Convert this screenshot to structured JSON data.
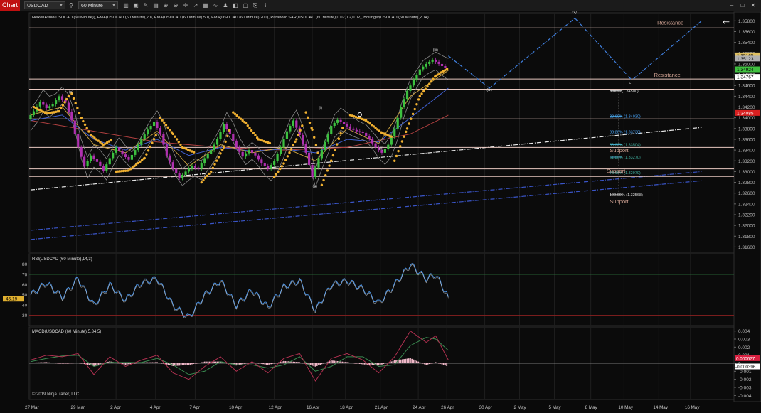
{
  "toolbar": {
    "chart_tab": "Chart",
    "instrument": "USDCAD",
    "period": "60 Minute",
    "icons": [
      "search-icon",
      "bar-chart-icon",
      "properties-icon",
      "pencil-icon",
      "templates-icon",
      "zoom-icon",
      "zoom-out-icon",
      "crosshair-icon",
      "draw-object-icon",
      "hide-panel-icon",
      "indicators-icon",
      "strategies-icon",
      "chart-style-icon",
      "data-box-icon",
      "attach-icon",
      "share-icon"
    ],
    "window_buttons": [
      "minimize-button",
      "maximize-button",
      "close-button"
    ]
  },
  "chart_data": {
    "type": "line",
    "title": "HeikenAshi8(USDCAD (60 Minute)), EMA(USDCAD (60 Minute),20), EMA(USDCAD (60 Minute),50), EMA(USDCAD (60 Minute),200), Parabolic SAR(USDCAD (60 Minute),0.02,0.2,0.02), Bollinger(USDCAD (60 Minute),2,14)",
    "x_labels": [
      "27 Mar",
      "29 Mar",
      "2 Apr",
      "4 Apr",
      "7 Apr",
      "10 Apr",
      "12 Apr",
      "16 Apr",
      "18 Apr",
      "21 Apr",
      "24 Apr",
      "26 Apr",
      "30 Apr",
      "2 May",
      "5 May",
      "8 May",
      "10 May",
      "14 May",
      "16 May"
    ],
    "price_panel": {
      "ylim": [
        1.315,
        1.3595
      ],
      "y_ticks": [
        "1.35800",
        "1.35600",
        "1.35400",
        "1.35200",
        "1.35000",
        "1.34800",
        "1.34600",
        "1.34400",
        "1.34200",
        "1.34000",
        "1.33800",
        "1.33600",
        "1.33400",
        "1.33200",
        "1.33000",
        "1.32800",
        "1.32600",
        "1.32400",
        "1.32200",
        "1.32000",
        "1.31800",
        "1.31600"
      ],
      "price_path": [
        [
          0,
          1.3398
        ],
        [
          2,
          1.3412
        ],
        [
          4,
          1.343
        ],
        [
          6,
          1.3418
        ],
        [
          8,
          1.3425
        ],
        [
          10,
          1.344
        ],
        [
          12,
          1.3428
        ],
        [
          14,
          1.3395
        ],
        [
          16,
          1.3345
        ],
        [
          18,
          1.331
        ],
        [
          20,
          1.333
        ],
        [
          22,
          1.3318
        ],
        [
          24,
          1.3302
        ],
        [
          26,
          1.3325
        ],
        [
          28,
          1.3345
        ],
        [
          30,
          1.3332
        ],
        [
          32,
          1.3322
        ],
        [
          34,
          1.334
        ],
        [
          36,
          1.336
        ],
        [
          38,
          1.3378
        ],
        [
          40,
          1.3392
        ],
        [
          42,
          1.337
        ],
        [
          44,
          1.333
        ],
        [
          46,
          1.3305
        ],
        [
          48,
          1.3288
        ],
        [
          50,
          1.33
        ],
        [
          52,
          1.331
        ],
        [
          54,
          1.3305
        ],
        [
          56,
          1.3325
        ],
        [
          58,
          1.334
        ],
        [
          60,
          1.336
        ],
        [
          62,
          1.3388
        ],
        [
          64,
          1.337
        ],
        [
          66,
          1.3345
        ],
        [
          68,
          1.3328
        ],
        [
          70,
          1.334
        ],
        [
          72,
          1.333
        ],
        [
          74,
          1.3315
        ],
        [
          76,
          1.3305
        ],
        [
          78,
          1.332
        ],
        [
          80,
          1.3345
        ],
        [
          82,
          1.3375
        ],
        [
          84,
          1.3395
        ],
        [
          86,
          1.3368
        ],
        [
          88,
          1.3335
        ],
        [
          90,
          1.329
        ],
        [
          92,
          1.3325
        ],
        [
          94,
          1.3355
        ],
        [
          96,
          1.3385
        ],
        [
          98,
          1.3396
        ],
        [
          100,
          1.3388
        ],
        [
          102,
          1.338
        ],
        [
          104,
          1.3375
        ],
        [
          106,
          1.3372
        ],
        [
          108,
          1.336
        ],
        [
          110,
          1.3345
        ],
        [
          112,
          1.3335
        ],
        [
          114,
          1.335
        ],
        [
          116,
          1.338
        ],
        [
          118,
          1.342
        ],
        [
          120,
          1.345
        ],
        [
          122,
          1.347
        ],
        [
          124,
          1.349
        ],
        [
          126,
          1.35
        ],
        [
          128,
          1.3508
        ],
        [
          130,
          1.35
        ],
        [
          132,
          1.3492
        ]
      ],
      "ema20": [
        [
          0,
          1.3405
        ],
        [
          10,
          1.342
        ],
        [
          20,
          1.335
        ],
        [
          30,
          1.3335
        ],
        [
          40,
          1.3375
        ],
        [
          50,
          1.331
        ],
        [
          60,
          1.335
        ],
        [
          70,
          1.3335
        ],
        [
          80,
          1.3345
        ],
        [
          90,
          1.332
        ],
        [
          100,
          1.338
        ],
        [
          110,
          1.3352
        ],
        [
          120,
          1.344
        ],
        [
          132,
          1.3488
        ]
      ],
      "ema50": [
        [
          0,
          1.3395
        ],
        [
          10,
          1.3405
        ],
        [
          20,
          1.336
        ],
        [
          30,
          1.334
        ],
        [
          40,
          1.336
        ],
        [
          50,
          1.333
        ],
        [
          60,
          1.3345
        ],
        [
          70,
          1.3338
        ],
        [
          80,
          1.3342
        ],
        [
          90,
          1.3335
        ],
        [
          100,
          1.336
        ],
        [
          110,
          1.3355
        ],
        [
          120,
          1.34
        ],
        [
          132,
          1.3455
        ]
      ],
      "ema200": [
        [
          0,
          1.3395
        ],
        [
          20,
          1.3375
        ],
        [
          40,
          1.3355
        ],
        [
          60,
          1.3345
        ],
        [
          80,
          1.334
        ],
        [
          100,
          1.3345
        ],
        [
          120,
          1.337
        ],
        [
          132,
          1.3405
        ]
      ],
      "sar_segments": [
        [
          [
            1,
            1.342
          ],
          [
            5,
            1.3408
          ],
          [
            9,
            1.3412
          ],
          [
            12,
            1.344
          ]
        ],
        [
          [
            13,
            1.3445
          ],
          [
            16,
            1.34
          ],
          [
            19,
            1.3368
          ],
          [
            23,
            1.335
          ],
          [
            26,
            1.336
          ]
        ],
        [
          [
            27,
            1.33
          ],
          [
            31,
            1.3302
          ],
          [
            36,
            1.3325
          ],
          [
            40,
            1.3372
          ]
        ],
        [
          [
            41,
            1.34
          ],
          [
            45,
            1.337
          ],
          [
            48,
            1.3345
          ],
          [
            52,
            1.3335
          ]
        ],
        [
          [
            54,
            1.328
          ],
          [
            57,
            1.33
          ],
          [
            61,
            1.3345
          ],
          [
            63,
            1.338
          ]
        ],
        [
          [
            64,
            1.341
          ],
          [
            68,
            1.339
          ],
          [
            72,
            1.336
          ],
          [
            76,
            1.3352
          ]
        ],
        [
          [
            77,
            1.329
          ],
          [
            80,
            1.3315
          ],
          [
            84,
            1.336
          ],
          [
            86,
            1.3388
          ]
        ],
        [
          [
            87,
            1.341
          ],
          [
            89,
            1.3378
          ],
          [
            91,
            1.333
          ]
        ],
        [
          [
            92,
            1.3275
          ],
          [
            95,
            1.332
          ],
          [
            99,
            1.3388
          ]
        ],
        [
          [
            101,
            1.3405
          ],
          [
            106,
            1.3395
          ],
          [
            111,
            1.3372
          ],
          [
            114,
            1.3365
          ]
        ],
        [
          [
            115,
            1.332
          ],
          [
            119,
            1.338
          ],
          [
            123,
            1.344
          ],
          [
            128,
            1.3478
          ],
          [
            132,
            1.3492
          ]
        ]
      ],
      "horizontal_levels": [
        1.3567,
        1.3472,
        1.3453,
        1.3398,
        1.3383,
        1.3345,
        1.3305,
        1.3291
      ],
      "fibonacci": [
        {
          "label": "0.00% (1.34500)",
          "value": 1.345
        },
        {
          "label": "23.60% (1.34030)",
          "value": 1.3403
        },
        {
          "label": "38.20% (1.33738)",
          "value": 1.3374
        },
        {
          "label": "50.00% (1.33504)",
          "value": 1.335
        },
        {
          "label": "61.80% (1.33270)",
          "value": 1.3327
        },
        {
          "label": "78.60% (1.32979)",
          "value": 1.3298
        },
        {
          "label": "100.00% (1.32568)",
          "value": 1.3257
        }
      ],
      "projection_path": [
        [
          132,
          1.3515
        ],
        [
          145,
          1.3455
        ],
        [
          172,
          1.3585
        ],
        [
          190,
          1.347
        ],
        [
          212,
          1.358
        ]
      ],
      "wave_labels": [
        {
          "text": "(x)",
          "x": 13,
          "y": 1.3446
        },
        {
          "text": "(y)",
          "x": 90,
          "y": 1.3271
        },
        {
          "text": "(i)",
          "x": 92,
          "y": 1.3416
        },
        {
          "text": "(ii)",
          "x": 111,
          "y": 1.3341
        },
        {
          "text": "(iii)",
          "x": 128,
          "y": 1.3524
        },
        {
          "text": "(iv)",
          "x": 145,
          "y": 1.345
        },
        {
          "text": "(v)",
          "x": 172,
          "y": 1.3595
        },
        {
          "text": "c",
          "x": 190,
          "y": 1.3463
        }
      ],
      "zone_labels": [
        {
          "text": "Resistance",
          "value": 1.3573,
          "x": 198
        },
        {
          "text": "Resistance",
          "value": 1.3476,
          "x": 197
        },
        {
          "text": "Support",
          "value": 1.3336,
          "x": 183
        },
        {
          "text": "Support",
          "value": 1.3298,
          "x": 182
        },
        {
          "text": "Support",
          "value": 1.3241,
          "x": 183
        }
      ],
      "trendlines": [
        {
          "style": "white",
          "from": [
            0,
            1.3266
          ],
          "to": [
            212,
            1.3382
          ]
        },
        {
          "style": "blue",
          "from": [
            0,
            1.3191
          ],
          "to": [
            212,
            1.33
          ]
        },
        {
          "style": "blue",
          "from": [
            0,
            1.3174
          ],
          "to": [
            212,
            1.3283
          ]
        }
      ],
      "price_tags": [
        {
          "text": "1.35165",
          "value": 1.3516,
          "bg": "#e0c060",
          "fg": "#000"
        },
        {
          "text": "1.35123",
          "value": 1.351,
          "bg": "#b0b0b0",
          "fg": "#000"
        },
        {
          "text": "1.34924",
          "value": 1.349,
          "bg": "#40c040",
          "fg": "#000"
        },
        {
          "text": "1.34767",
          "value": 1.3476,
          "bg": "#ffffff",
          "fg": "#000"
        },
        {
          "text": "1.34085",
          "value": 1.3409,
          "bg": "#d82020",
          "fg": "#fff"
        }
      ]
    },
    "rsi_panel": {
      "title": "RSI(USDCAD (60 Minute),14,3)",
      "ylim": [
        20,
        90
      ],
      "y_ticks": [
        "80",
        "70",
        "60",
        "50",
        "40",
        "30"
      ],
      "levels": [
        70,
        30
      ],
      "current_value": "46.19",
      "series": [
        [
          0,
          50
        ],
        [
          5,
          62
        ],
        [
          10,
          48
        ],
        [
          15,
          66
        ],
        [
          20,
          40
        ],
        [
          25,
          60
        ],
        [
          30,
          45
        ],
        [
          35,
          62
        ],
        [
          40,
          66
        ],
        [
          45,
          40
        ],
        [
          50,
          28
        ],
        [
          55,
          50
        ],
        [
          60,
          64
        ],
        [
          65,
          40
        ],
        [
          70,
          55
        ],
        [
          75,
          38
        ],
        [
          80,
          58
        ],
        [
          85,
          64
        ],
        [
          90,
          35
        ],
        [
          95,
          60
        ],
        [
          100,
          64
        ],
        [
          105,
          56
        ],
        [
          110,
          42
        ],
        [
          115,
          60
        ],
        [
          120,
          80
        ],
        [
          125,
          66
        ],
        [
          128,
          70
        ],
        [
          132,
          48
        ]
      ]
    },
    "macd_panel": {
      "title": "MACD(USDCAD (60 Minute),5,34,5)",
      "ylim": [
        -0.0045,
        0.0045
      ],
      "y_ticks": [
        "0.004",
        "0.003",
        "0.002",
        "0.001",
        "0",
        "-0.001",
        "-0.002",
        "-0.003",
        "-0.004"
      ],
      "current_values": [
        "0.000627",
        "-0.000396"
      ],
      "macd": [
        [
          0,
          0.0004
        ],
        [
          5,
          0.001
        ],
        [
          10,
          0.0008
        ],
        [
          15,
          0.0012
        ],
        [
          20,
          -0.0014
        ],
        [
          25,
          0.0008
        ],
        [
          30,
          -0.0004
        ],
        [
          35,
          0.0004
        ],
        [
          40,
          0.001
        ],
        [
          45,
          -0.0012
        ],
        [
          50,
          -0.002
        ],
        [
          55,
          -0.0004
        ],
        [
          60,
          0.0008
        ],
        [
          65,
          -0.001
        ],
        [
          70,
          0.0002
        ],
        [
          75,
          -0.0012
        ],
        [
          80,
          0.0006
        ],
        [
          85,
          0.0012
        ],
        [
          90,
          -0.0022
        ],
        [
          95,
          0.0006
        ],
        [
          100,
          0.0012
        ],
        [
          105,
          0.0004
        ],
        [
          110,
          -0.0012
        ],
        [
          115,
          0.0008
        ],
        [
          120,
          0.004
        ],
        [
          125,
          0.0026
        ],
        [
          128,
          0.0034
        ],
        [
          132,
          0.0004
        ]
      ],
      "signal": [
        [
          0,
          0.0002
        ],
        [
          5,
          0.0006
        ],
        [
          10,
          0.0009
        ],
        [
          15,
          0.001
        ],
        [
          20,
          -0.0004
        ],
        [
          25,
          0.0001
        ],
        [
          30,
          0.0001
        ],
        [
          35,
          0.0001
        ],
        [
          40,
          0.0006
        ],
        [
          45,
          -0.0002
        ],
        [
          50,
          -0.0014
        ],
        [
          55,
          -0.001
        ],
        [
          60,
          0.0002
        ],
        [
          65,
          -0.0002
        ],
        [
          70,
          -0.0002
        ],
        [
          75,
          -0.0006
        ],
        [
          80,
          -0.0002
        ],
        [
          85,
          0.0008
        ],
        [
          90,
          -0.001
        ],
        [
          95,
          -0.0004
        ],
        [
          100,
          0.0008
        ],
        [
          105,
          0.0008
        ],
        [
          110,
          -0.0004
        ],
        [
          115,
          -0.0002
        ],
        [
          120,
          0.0022
        ],
        [
          125,
          0.0032
        ],
        [
          128,
          0.003
        ],
        [
          132,
          0.0016
        ]
      ]
    },
    "copyright": "© 2019 NinjaTrader, LLC"
  }
}
